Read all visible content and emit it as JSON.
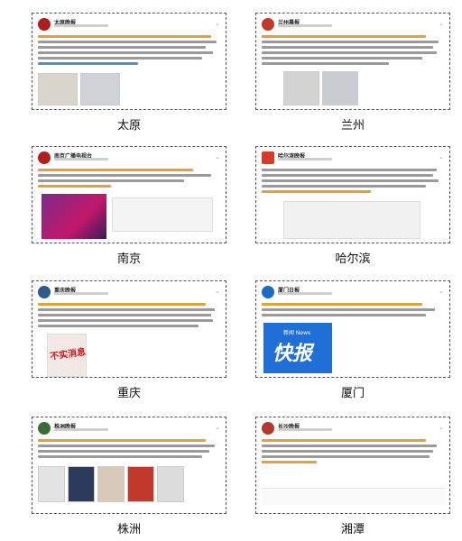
{
  "cells": [
    {
      "city": "太原",
      "account": "太原晚报",
      "avatar_color": "#b01d1d"
    },
    {
      "city": "兰州",
      "account": "兰州晨报",
      "avatar_color": "#c0392b"
    },
    {
      "city": "南京",
      "account": "南京广播电视台",
      "avatar_color": "#b0201e"
    },
    {
      "city": "哈尔滨",
      "account": "哈尔滨晚报",
      "avatar_color": "#d63b2a"
    },
    {
      "city": "重庆",
      "account": "重庆晚报",
      "avatar_color": "#2d5a8a"
    },
    {
      "city": "厦门",
      "account": "厦门日报",
      "avatar_color": "#1d6cc4"
    },
    {
      "city": "株洲",
      "account": "株洲晚报",
      "avatar_color": "#3d6b3a"
    },
    {
      "city": "湘潭",
      "account": "长沙晚报",
      "avatar_color": "#b23a2c"
    }
  ],
  "overlays": {
    "chongqing_stamp": "不实消息",
    "xiamen_badge_top": "新闻 News",
    "xiamen_badge_main": "快报"
  }
}
